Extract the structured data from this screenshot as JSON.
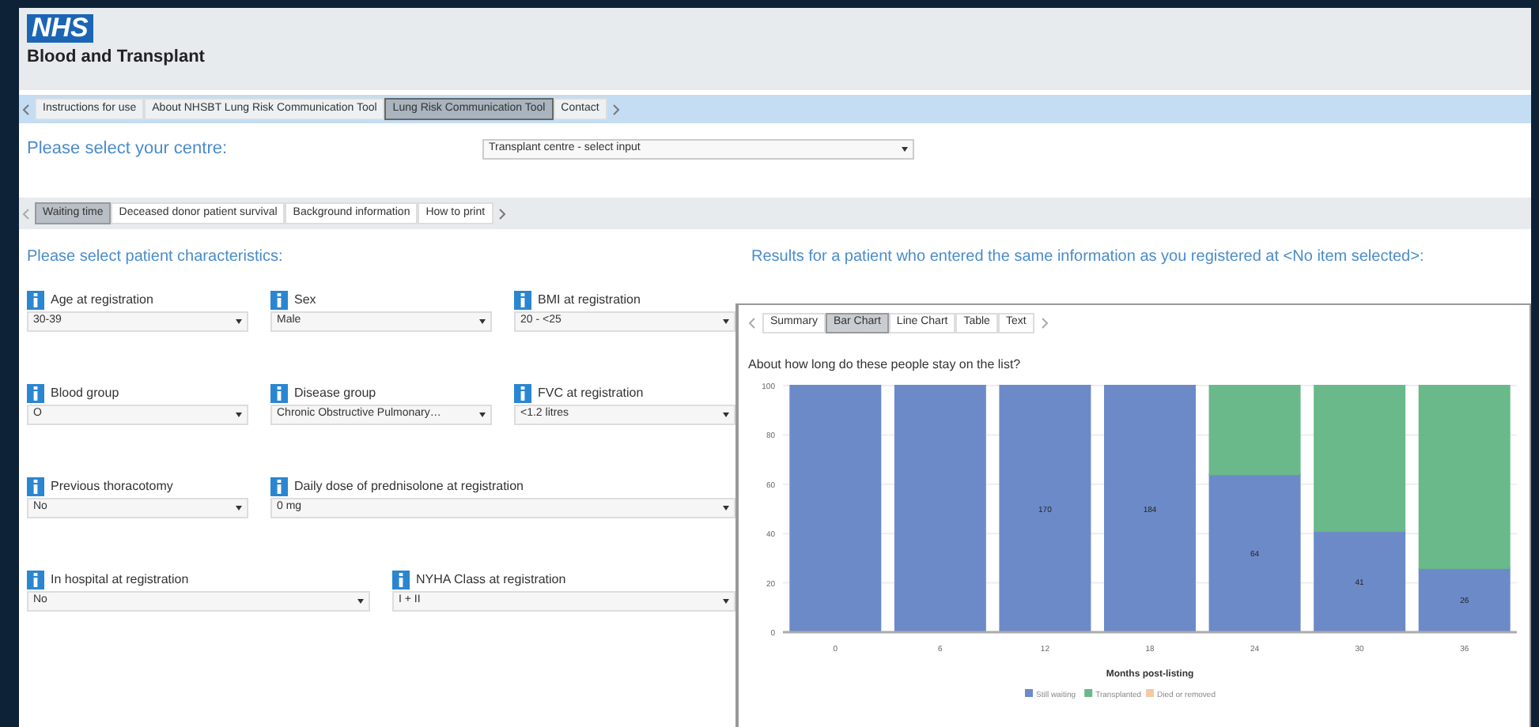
{
  "header": {
    "logo": "NHS",
    "subtitle": "Blood and Transplant"
  },
  "nav_tabs": [
    {
      "label": "Instructions for use",
      "selected": false
    },
    {
      "label": "About NHSBT Lung Risk Communication Tool",
      "selected": false
    },
    {
      "label": "Lung Risk Communication Tool",
      "selected": true
    },
    {
      "label": "Contact",
      "selected": false
    }
  ],
  "centre": {
    "label": "Please select your centre:",
    "value": "Transplant centre - select input"
  },
  "section_tabs": [
    {
      "label": "Waiting time",
      "selected": true
    },
    {
      "label": "Deceased donor patient survival",
      "selected": false
    },
    {
      "label": "Background information",
      "selected": false
    },
    {
      "label": "How to print",
      "selected": false
    }
  ],
  "characteristics": {
    "title": "Please select patient characteristics:",
    "rows": [
      [
        {
          "label": "Age at registration",
          "value": "30-39"
        },
        {
          "label": "Sex",
          "value": "Male"
        },
        {
          "label": "BMI at registration",
          "value": "20 - <25"
        }
      ],
      [
        {
          "label": "Blood group",
          "value": "O"
        },
        {
          "label": "Disease group",
          "value": "Chronic Obstructive Pulmonary…"
        },
        {
          "label": "FVC at registration",
          "value": "<1.2 litres"
        }
      ],
      [
        {
          "label": "Previous thoracotomy",
          "value": "No"
        },
        {
          "label": "Daily dose of prednisolone at registration",
          "value": "0 mg"
        }
      ],
      [
        {
          "label": "In hospital at registration",
          "value": "No"
        },
        {
          "label": "NYHA Class at registration",
          "value": "I + II"
        }
      ]
    ]
  },
  "results": {
    "title": "Results for a patient who entered the same information as you registered at <No item selected>:",
    "tabs": [
      {
        "label": "Summary",
        "selected": false
      },
      {
        "label": "Bar Chart",
        "selected": true
      },
      {
        "label": "Line Chart",
        "selected": false
      },
      {
        "label": "Table",
        "selected": false
      },
      {
        "label": "Text",
        "selected": false
      }
    ],
    "chart_data": {
      "type": "bar",
      "stacked": true,
      "grid": true,
      "legend": "bottom",
      "title": "About how long do these people stay on the list?",
      "xlabel": "Months post-listing",
      "categories": [
        "0",
        "6",
        "12",
        "18",
        "24",
        "30",
        "36"
      ],
      "ylim": [
        0,
        100
      ],
      "yticks": [
        0,
        20,
        40,
        60,
        80,
        100
      ],
      "series": [
        {
          "name": "Still waiting",
          "color": "#6d8ac8",
          "values": [
            100,
            100,
            100,
            100,
            64,
            41,
            26
          ]
        },
        {
          "name": "Transplanted",
          "color": "#6ab98a",
          "values": [
            0,
            0,
            0,
            0,
            36,
            59,
            74
          ]
        },
        {
          "name": "Died or removed",
          "color": "#f5c9a6",
          "values": [
            0,
            0,
            0,
            0,
            0,
            0,
            0
          ]
        }
      ],
      "value_labels": [
        null,
        null,
        "170",
        "184",
        "64",
        "41",
        "26"
      ]
    }
  }
}
